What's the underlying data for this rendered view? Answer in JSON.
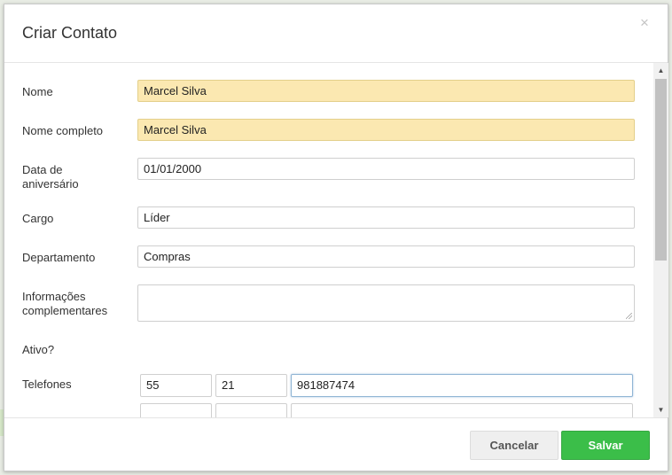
{
  "modal": {
    "title": "Criar Contato",
    "close_glyph": "×"
  },
  "form": {
    "nome": {
      "label": "Nome",
      "value": "Marcel Silva"
    },
    "nome_completo": {
      "label": "Nome completo",
      "value": "Marcel Silva"
    },
    "aniversario": {
      "label_line1": "Data de",
      "label_line2": "aniversário",
      "value": "01/01/2000"
    },
    "cargo": {
      "label": "Cargo",
      "value": "Líder"
    },
    "departamento": {
      "label": "Departamento",
      "value": "Compras"
    },
    "informacoes": {
      "label_line1": "Informações",
      "label_line2": "complementares",
      "value": ""
    },
    "ativo": {
      "label": "Ativo?"
    },
    "telefones": {
      "label": "Telefones",
      "rows": [
        {
          "country": "55",
          "area": "21",
          "number": "981887474"
        },
        {
          "country": "",
          "area": "",
          "number": ""
        }
      ]
    }
  },
  "footer": {
    "cancel_label": "Cancelar",
    "save_label": "Salvar"
  },
  "colors": {
    "autofill": "#fbe8b1",
    "save": "#3bbe49"
  }
}
